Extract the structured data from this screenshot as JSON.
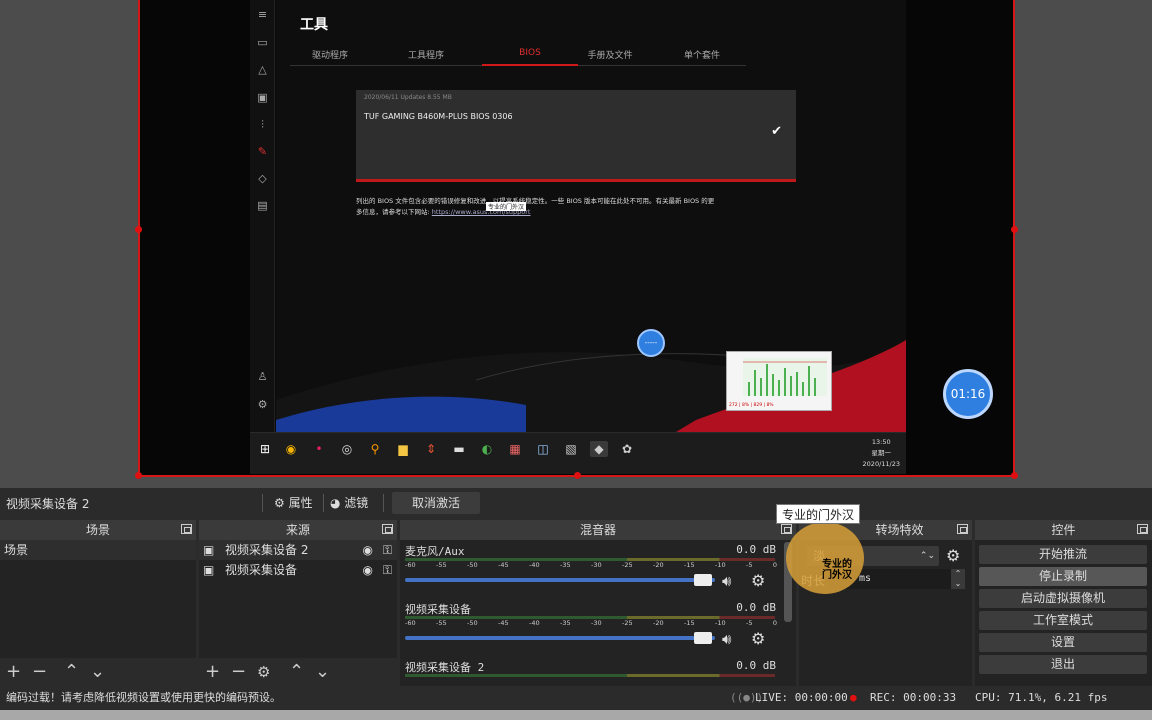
{
  "armoury": {
    "title": "工具",
    "tabs": [
      "驱动程序",
      "工具程序",
      "BIOS",
      "手册及文件",
      "单个套件"
    ],
    "active_tab": "BIOS",
    "bios_meta": "2020/06/11 Updates   8.55 MB",
    "bios_name": "TUF GAMING B460M-PLUS BIOS 0306",
    "note_line1": "列出的 BIOS 文件包含必要的错误修复和改进，以提高系统稳定性。一些 BIOS 版本可能在此处不可用。有关最新 BIOS 的更",
    "note_line2": "多信息，请参考以下网站:",
    "note_url": "https://www.asus.com/support",
    "watermark_small": "专业的门外汉",
    "clock_time": "13:50",
    "clock_day": "星期一",
    "clock_date": "2020/11/23",
    "chart_labels": [
      "40",
      "32",
      "24",
      "16",
      "8",
      "0"
    ],
    "chart_footer": "272 | 8% | 829 | 8%"
  },
  "overlays": {
    "blue_dot_text": "-----",
    "timer": "01:16",
    "tooltip": "专业的门外汉",
    "orange_text": "专业的\n门外汉"
  },
  "source_bar": {
    "name": "视频采集设备 2",
    "properties": "属性",
    "filters": "滤镜",
    "deactivate": "取消激活"
  },
  "docks": {
    "scenes": {
      "title": "场景",
      "items": [
        "场景"
      ]
    },
    "sources": {
      "title": "来源",
      "items": [
        "视频采集设备 2",
        "视频采集设备"
      ]
    },
    "mixer": {
      "title": "混音器",
      "tracks": [
        {
          "name": "麦克风/Aux",
          "db": "0.0 dB"
        },
        {
          "name": "视频采集设备",
          "db": "0.0 dB"
        },
        {
          "name": "视频采集设备 2",
          "db": "0.0 dB"
        }
      ],
      "ticks": [
        "-60",
        "-55",
        "-50",
        "-45",
        "-40",
        "-35",
        "-30",
        "-25",
        "-20",
        "-15",
        "-10",
        "-5",
        "0"
      ]
    },
    "transitions": {
      "title": "转场特效",
      "transition_value": "淡",
      "duration_label": "时长",
      "duration_value": "ms"
    },
    "controls": {
      "title": "控件",
      "buttons": [
        "开始推流",
        "停止录制",
        "启动虚拟摄像机",
        "工作室模式",
        "设置",
        "退出"
      ]
    }
  },
  "status": {
    "message": "编码过载！请考虑降低视频设置或使用更快的编码预设。",
    "live": "LIVE: 00:00:00",
    "rec": "REC: 00:00:33",
    "cpu": "CPU: 71.1%, 6.21 fps"
  },
  "colors": {
    "accent_red": "#d41616",
    "rec_red": "#e01010",
    "blue": "#2f7fe0"
  }
}
